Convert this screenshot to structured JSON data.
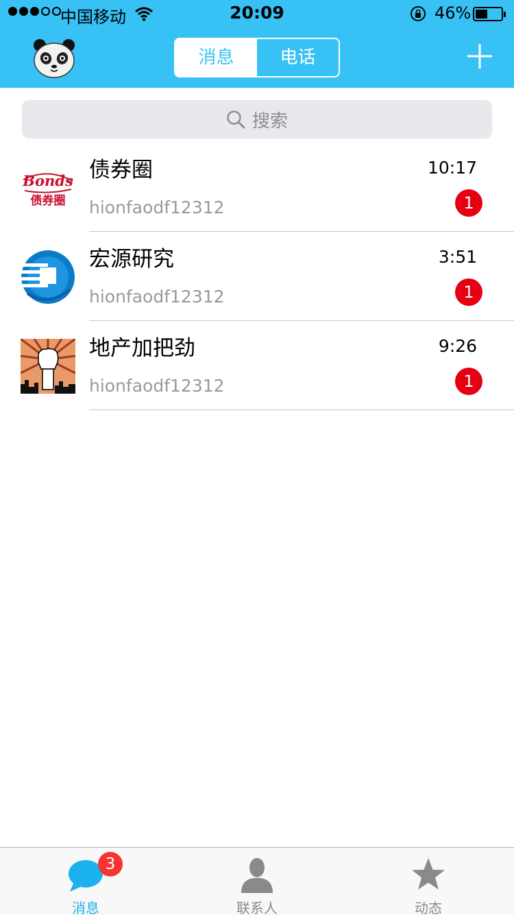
{
  "status_bar": {
    "carrier": "中国移动",
    "time": "20:09",
    "battery_text": "46%",
    "battery_level": 0.46,
    "signal_bars_filled": 3,
    "signal_bars_total": 5
  },
  "nav": {
    "avatar_icon": "panda-avatar-icon",
    "tabs": [
      {
        "label": "消息",
        "selected": true
      },
      {
        "label": "电话",
        "selected": false
      }
    ],
    "add_icon": "plus-icon"
  },
  "search": {
    "placeholder": "搜索",
    "icon": "search-icon"
  },
  "chats": [
    {
      "name": "债券圈",
      "preview": "hionfaodf12312",
      "time": "10:17",
      "unread": "1",
      "avatar": "bonds-logo-icon"
    },
    {
      "name": "宏源研究",
      "preview": "hionfaodf12312",
      "time": "3:51",
      "unread": "1",
      "avatar": "hongyuan-logo-icon"
    },
    {
      "name": "地产加把劲",
      "preview": "hionfaodf12312",
      "time": "9:26",
      "unread": "1",
      "avatar": "fist-poster-icon"
    }
  ],
  "tabbar": {
    "items": [
      {
        "label": "消息",
        "icon": "chat-bubble-icon",
        "badge": "3",
        "active": true
      },
      {
        "label": "联系人",
        "icon": "contact-person-icon",
        "active": false
      },
      {
        "label": "动态",
        "icon": "star-icon",
        "active": false
      }
    ]
  },
  "colors": {
    "header": "#37c1f5",
    "badge": "#e60012",
    "tab_active": "#1bb0ee"
  }
}
